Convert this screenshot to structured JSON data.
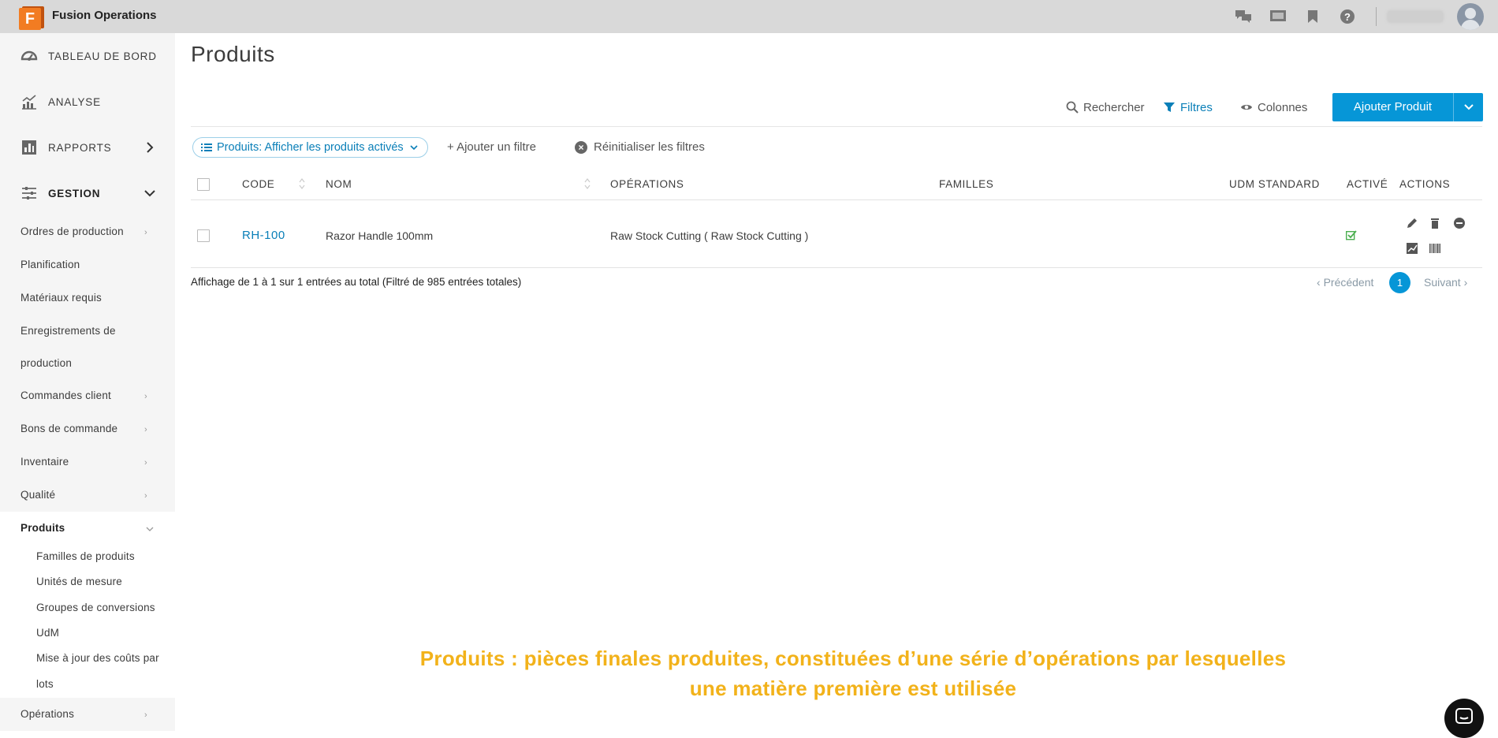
{
  "app": {
    "title": "Fusion Operations",
    "logo_letter": "F"
  },
  "topbar": {
    "icons": [
      "chat-icon",
      "screen-icon",
      "bookmark-icon",
      "help-icon"
    ],
    "user_avatar": "avatar-icon"
  },
  "sidebar": {
    "main_items": [
      {
        "label": "TABLEAU DE BORD",
        "icon": "dashboard-icon"
      },
      {
        "label": "ANALYSE",
        "icon": "analytics-icon"
      },
      {
        "label": "RAPPORTS",
        "icon": "reports-icon"
      },
      {
        "label": "GESTION",
        "icon": "management-icon"
      }
    ],
    "sub_items": [
      {
        "label": "Ordres de production",
        "has_chevron": true
      },
      {
        "label": "Planification",
        "has_chevron": false
      },
      {
        "label": "Matériaux requis",
        "has_chevron": false
      },
      {
        "label": "Enregistrements de",
        "has_chevron": false
      },
      {
        "label": "production",
        "has_chevron": false
      },
      {
        "label": "Commandes client",
        "has_chevron": true
      },
      {
        "label": "Bons de commande",
        "has_chevron": true
      },
      {
        "label": "Inventaire",
        "has_chevron": true
      },
      {
        "label": "Qualité",
        "has_chevron": true
      },
      {
        "label": "Produits",
        "has_chevron": true
      }
    ],
    "produits_children": [
      "Familles de produits",
      "Unités de mesure",
      "Groupes de conversions",
      "UdM",
      "Mise à jour des coûts par",
      "lots"
    ],
    "after_item": {
      "label": "Opérations"
    }
  },
  "main": {
    "title": "Produits",
    "toolbar": {
      "search": "Rechercher",
      "filters": "Filtres",
      "columns": "Colonnes",
      "add_button": "Ajouter Produit"
    },
    "filters": {
      "active_filter": "Produits: Afficher les produits activés",
      "add_filter": "+ Ajouter un filtre",
      "reset": "Réinitialiser les filtres"
    },
    "table": {
      "columns": [
        "CODE",
        "NOM",
        "OPÉRATIONS",
        "FAMILLES",
        "UDM STANDARD",
        "ACTIVÉ",
        "ACTIONS"
      ],
      "rows": [
        {
          "code": "RH-100",
          "name": "Razor Handle 100mm",
          "operations": "Raw Stock Cutting ( Raw Stock Cutting )",
          "families": "",
          "udm": "",
          "active": true
        }
      ]
    },
    "footer": {
      "info": "Affichage de 1 à 1 sur 1 entrées au total (Filtré de 985 entrées totales)",
      "prev": "Précédent",
      "page": "1",
      "next": "Suivant"
    }
  },
  "caption": {
    "line1": "Produits : pièces finales produites, constituées d’une série d’opérations par lesquelles",
    "line2": "une matière première est utilisée"
  },
  "colors": {
    "accent": "#0696d7",
    "caption": "#f2b21a",
    "active_check": "#4caf50"
  }
}
